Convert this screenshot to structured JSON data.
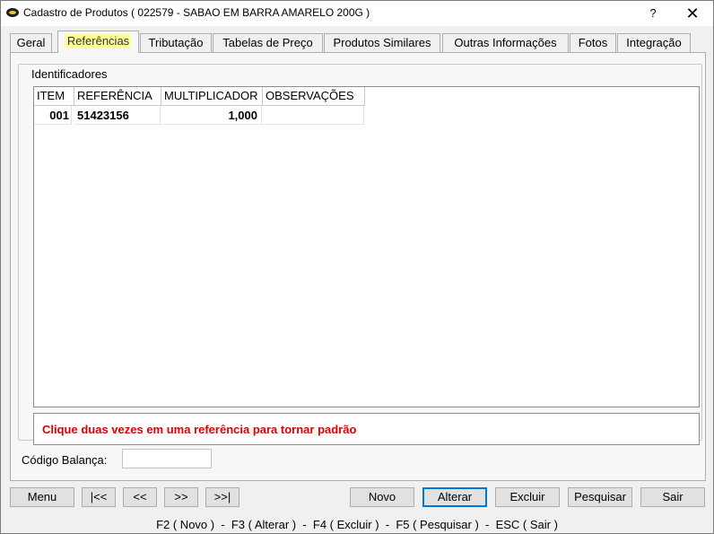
{
  "window": {
    "title": "Cadastro de Produtos ( 022579 - SABAO EM BARRA AMARELO 200G )",
    "help_label": "?",
    "close_label": "✕"
  },
  "tabs": [
    {
      "label": "Geral"
    },
    {
      "label": "Referências",
      "active": true
    },
    {
      "label": "Tributação"
    },
    {
      "label": "Tabelas de Preço"
    },
    {
      "label": "Produtos Similares"
    },
    {
      "label": "Outras Informações"
    },
    {
      "label": "Fotos"
    },
    {
      "label": "Integração"
    }
  ],
  "identificadores": {
    "group_label": "Identificadores",
    "columns": [
      "ITEM",
      "REFERÊNCIA",
      "MULTIPLICADOR",
      "OBSERVAÇÕES"
    ],
    "rows": [
      {
        "item": "001",
        "referencia": "51423156",
        "multiplicador": "1,000",
        "observacoes": ""
      }
    ],
    "hint": "Clique duas vezes em uma referência para tornar padrão"
  },
  "codigo_balanca": {
    "label": "Código Balança:",
    "value": ""
  },
  "buttons": {
    "menu": "Menu",
    "first": "|<<",
    "prev": "<<",
    "next": ">>",
    "last": ">>|",
    "novo": "Novo",
    "alterar": "Alterar",
    "excluir": "Excluir",
    "pesquisar": "Pesquisar",
    "sair": "Sair"
  },
  "shortcuts": "F2 ( Novo )  -  F3 ( Alterar )  -  F4 ( Excluir )  -  F5 ( Pesquisar )  -  ESC ( Sair )",
  "colors": {
    "active_tab_highlight": "#ffff99",
    "hint_text": "#e00000",
    "default_button_border": "#0078d7"
  }
}
